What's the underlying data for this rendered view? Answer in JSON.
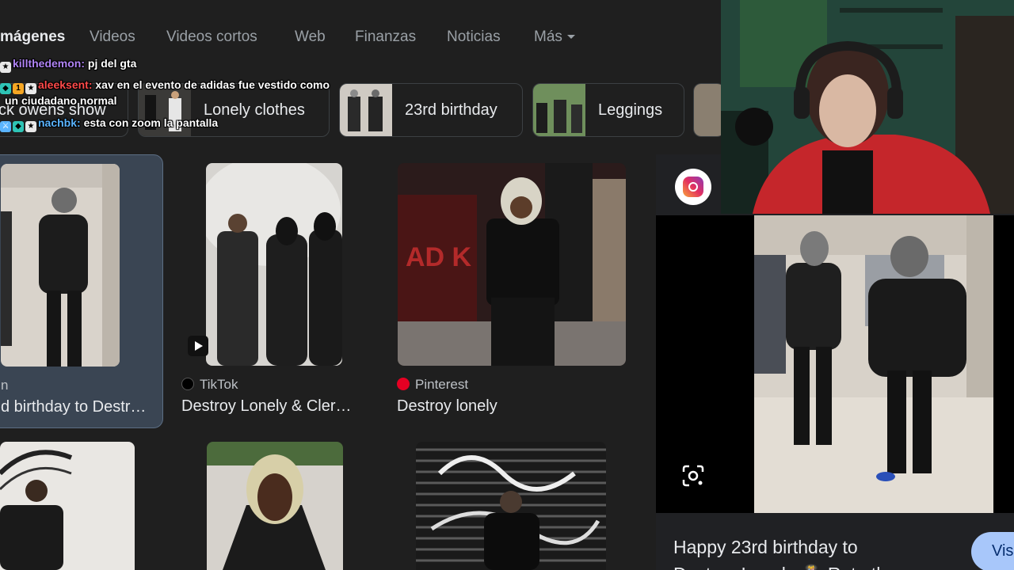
{
  "nav": {
    "tabs": [
      {
        "label": "mágenes",
        "active": true
      },
      {
        "label": "Videos"
      },
      {
        "label": "Videos cortos"
      },
      {
        "label": "Web"
      },
      {
        "label": "Finanzas"
      },
      {
        "label": "Noticias"
      },
      {
        "label": "Más"
      }
    ]
  },
  "chips": [
    {
      "label": "ck owens show"
    },
    {
      "label": "Lonely clothes"
    },
    {
      "label": "23rd birthday"
    },
    {
      "label": "Leggings"
    }
  ],
  "chat": [
    {
      "user": "killthedemon:",
      "user_color": "#b084f5",
      "message": "pj del gta"
    },
    {
      "user": "aleeksent:",
      "user_color": "#ff4a4a",
      "message": "xav en el evento de adidas fue vestido como"
    },
    {
      "user": "",
      "user_color": "#ffffff",
      "message": "un ciudadano normal"
    },
    {
      "user": "nachbk:",
      "user_color": "#5ab4ff",
      "message": "esta con zoom la pantalla"
    }
  ],
  "results": [
    {
      "source": "n",
      "title": "d birthday to Destr…"
    },
    {
      "source": "TikTok",
      "title": "Destroy Lonely & Cler…"
    },
    {
      "source": "Pinterest",
      "title": "Destroy lonely"
    }
  ],
  "panel": {
    "title_line1": "Happy 23rd birthday to",
    "title_line2": "Destroy Lonely 🎂 Rate the",
    "visit_label": "Vis"
  },
  "colors": {
    "background": "#1f1f1f",
    "selected_card": "#3a4553",
    "visit_button": "#a8c7fa",
    "pinterest": "#e60023"
  }
}
